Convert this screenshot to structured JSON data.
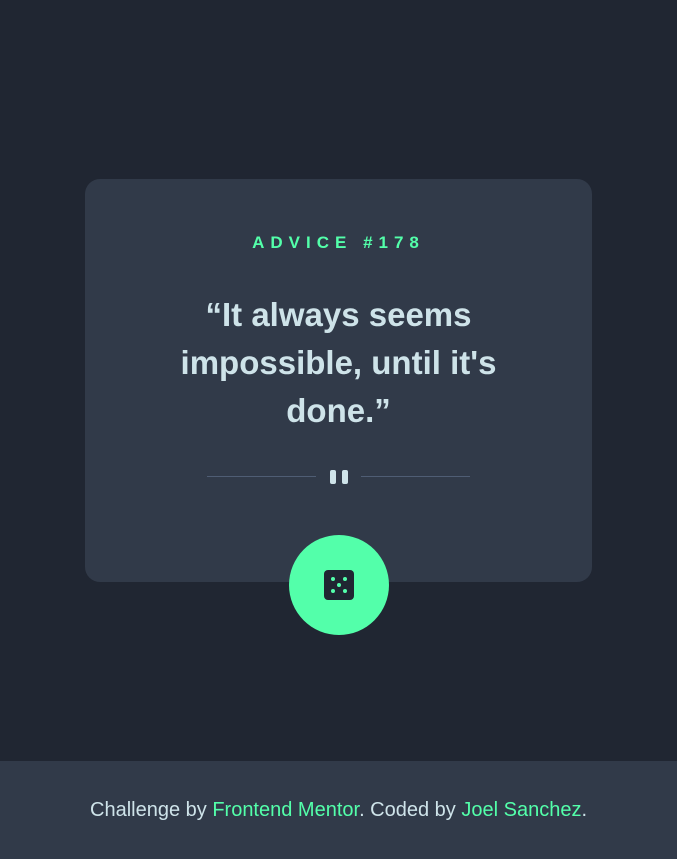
{
  "advice": {
    "label": "ADVICE #178",
    "quote_line_1": "“It always seems",
    "quote_line_2": "impossible, until it's",
    "quote_line_3": "done.”"
  },
  "icons": {
    "divider_icon": "pause-icon",
    "button_icon": "dice-icon"
  },
  "footer": {
    "prefix": "Challenge by ",
    "challenge_link": "Frontend Mentor",
    "middle": ". Coded by ",
    "author_link": "Joel Sanchez",
    "suffix": "."
  },
  "colors": {
    "background": "#202632",
    "card": "#313A49",
    "accent": "#53FFAA",
    "text": "#CEE3E9",
    "divider": "#4F5D74"
  }
}
